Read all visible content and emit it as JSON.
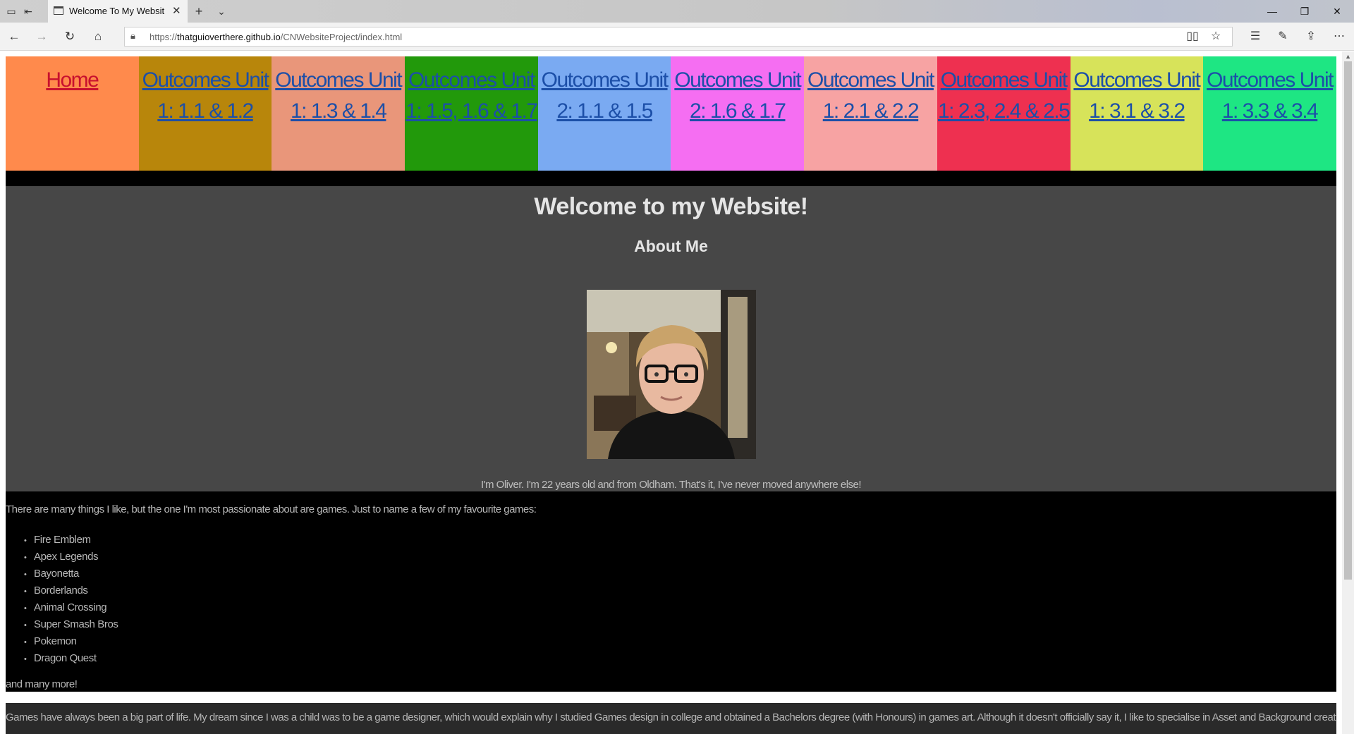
{
  "browser": {
    "tab_title": "Welcome To My Websit",
    "url_prefix": "https://",
    "url_host": "thatguioverthere.github.io",
    "url_path": "/CNWebsiteProject/index.html"
  },
  "nav": [
    {
      "label": "Home",
      "color": "#ff8a4c"
    },
    {
      "label": "Outcomes Unit 1: 1.1 & 1.2",
      "color": "#b8860b"
    },
    {
      "label": "Outcomes Unit 1: 1.3 & 1.4",
      "color": "#e9967a"
    },
    {
      "label": "Outcomes Unit 1: 1.5, 1.6 & 1.7",
      "color": "#22990b"
    },
    {
      "label": "Outcomes Unit 2: 1.1 & 1.5",
      "color": "#7aaaf2"
    },
    {
      "label": "Outcomes Unit 2: 1.6 & 1.7",
      "color": "#f56ef2"
    },
    {
      "label": "Outcomes Unit 1: 2.1 & 2.2",
      "color": "#f7a3a3"
    },
    {
      "label": "Outcomes Unit 1: 2.3, 2.4 & 2.5",
      "color": "#ee3050"
    },
    {
      "label": "Outcomes Unit 1: 3.1 & 3.2",
      "color": "#d7e35a"
    },
    {
      "label": "Outcomes Unit 1: 3.3 & 3.4",
      "color": "#1ee683"
    }
  ],
  "hero": {
    "title": "Welcome to my Website!",
    "subtitle": "About Me",
    "bio": "I'm Oliver. I'm 22 years old and from Oldham. That's it, I've never moved anywhere else!"
  },
  "games": {
    "intro": "There are many things I like, but the one I'm most passionate about are games. Just to name a few of my favourite games:",
    "items": [
      "Fire Emblem",
      "Apex Legends",
      "Bayonetta",
      "Borderlands",
      "Animal Crossing",
      "Super Smash Bros",
      "Pokemon",
      "Dragon Quest"
    ],
    "outro": "and many more!"
  },
  "paragraph": "Games have always been a big part of life. My dream since I was a child was to be a game designer, which would explain why I studied Games design in college and obtained a Bachelors degree (with Honours) in games art. Although it doesn't officially say it, I like to specialise in Asset and Background creation."
}
